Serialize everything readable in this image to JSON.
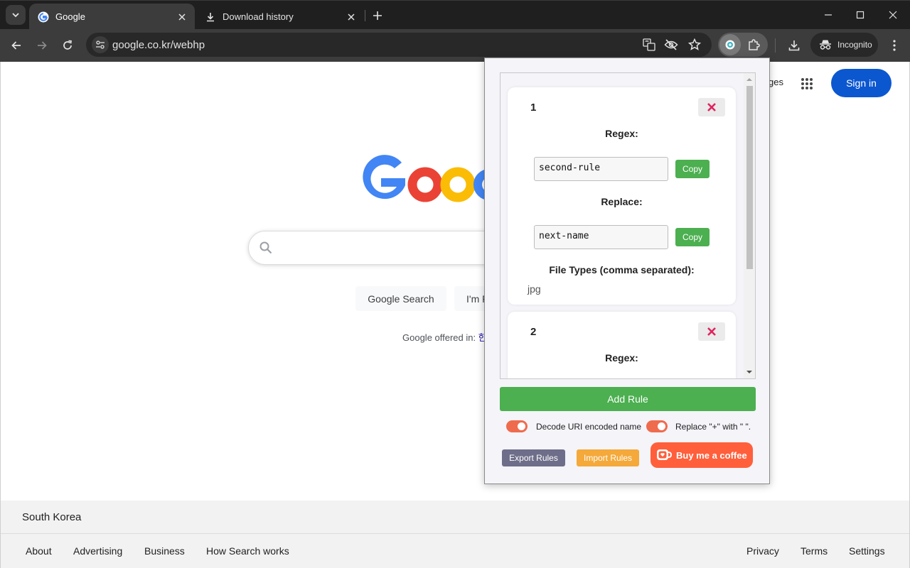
{
  "browser": {
    "tabs": [
      {
        "title": "Google",
        "active": true
      },
      {
        "title": "Download history",
        "active": false
      }
    ],
    "url": "google.co.kr/webhp",
    "incognito_label": "Incognito"
  },
  "google": {
    "header_link_partial": "ges",
    "sign_in": "Sign in",
    "buttons": {
      "search": "Google Search",
      "lucky_partial": "I'm F"
    },
    "offered_in": "Google offered in:",
    "offered_lang_partial": "한",
    "country": "South Korea",
    "footer_left": [
      "About",
      "Advertising",
      "Business",
      "How Search works"
    ],
    "footer_right": [
      "Privacy",
      "Terms",
      "Settings"
    ]
  },
  "popup": {
    "rules": [
      {
        "number": "1",
        "regex_label": "Regex:",
        "regex": "second-rule",
        "copy_label": "Copy",
        "replace_label": "Replace:",
        "replace": "next-name",
        "file_types_label": "File Types (comma separated):",
        "file_types": "jpg"
      },
      {
        "number": "2",
        "regex_label": "Regex:"
      }
    ],
    "add_rule": "Add Rule",
    "toggles": [
      {
        "label": "Decode URI encoded name",
        "on": true
      },
      {
        "label": "Replace \"+\" with \" \".",
        "on": true
      }
    ],
    "export_rules": "Export Rules",
    "import_rules": "Import Rules",
    "buy_coffee": "Buy me a coffee",
    "colors": {
      "green": "#4caf50",
      "toggle": "#ef6b4d",
      "export": "#6e6e8a",
      "import": "#f4a93a",
      "coffee": "#ff5f3b",
      "delete_x": "#e0245e"
    }
  }
}
